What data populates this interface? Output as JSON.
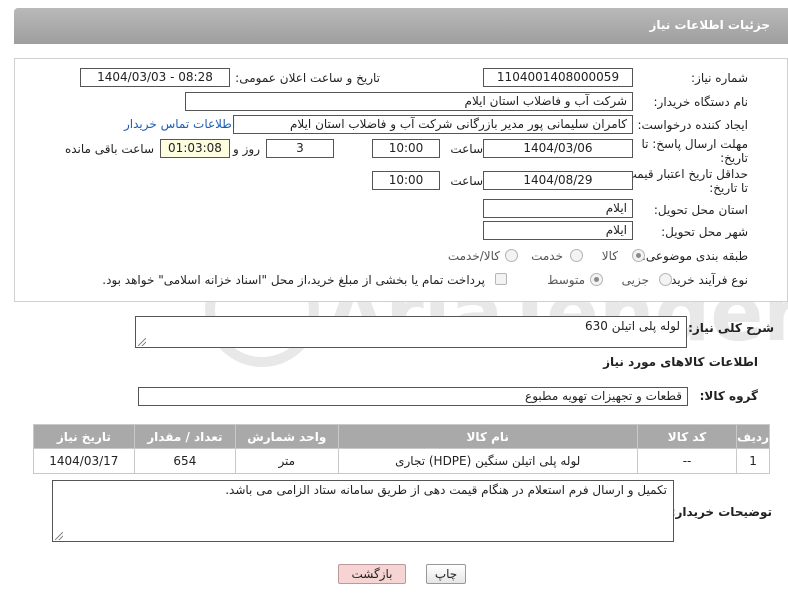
{
  "header": {
    "title": "جزئیات اطلاعات نیاز"
  },
  "fields": {
    "need_number_label": "شماره نیاز:",
    "need_number": "1104001408000059",
    "announce_label": "تاریخ و ساعت اعلان عمومی:",
    "announce_value": "1404/03/03 - 08:28",
    "buyer_org_label": "نام دستگاه خریدار:",
    "buyer_org": "شرکت آب و فاضلاب استان ایلام",
    "creator_label": "ایجاد کننده درخواست:",
    "creator": "کامران سلیمانی پور مدیر بازرگانی شرکت آب و فاضلاب استان ایلام",
    "buyer_contact_link": "اطلاعات تماس خریدار",
    "deadline_label_1": "مهلت ارسال پاسخ: تا",
    "deadline_label_2": "تاریخ:",
    "deadline_date": "1404/03/06",
    "time_label": "ساعت",
    "deadline_time": "10:00",
    "days_value": "3",
    "days_label": "روز و",
    "remaining_time": "01:03:08",
    "remaining_label": "ساعت باقی مانده",
    "price_valid_label_1": "حداقل تاریخ اعتبار قیمت:",
    "price_valid_label_2": "تا تاریخ:",
    "price_valid_date": "1404/08/29",
    "price_valid_time": "10:00",
    "province_label": "استان محل تحویل:",
    "province": "ایلام",
    "city_label": "شهر محل تحویل:",
    "city": "ایلام",
    "category_label": "طبقه بندی موضوعی:",
    "category_options": [
      "کالا",
      "خدمت",
      "کالا/خدمت"
    ],
    "process_label": "نوع فرآیند خرید :",
    "process_options": [
      "جزیی",
      "متوسط"
    ],
    "payment_note": "پرداخت تمام یا بخشی از مبلغ خرید،از محل \"اسناد خزانه اسلامی\" خواهد بود."
  },
  "description": {
    "label": "شرح کلی نیاز:",
    "value": "لوله پلی اتیلن 630"
  },
  "goods_section": {
    "title": "اطلاعات کالاهای مورد نیاز",
    "group_label": "گروه کالا:",
    "group_value": "قطعات و تجهیزات تهویه مطبوع"
  },
  "table": {
    "headers": [
      "ردیف",
      "کد کالا",
      "نام کالا",
      "واحد شمارش",
      "تعداد / مقدار",
      "تاریخ نیاز"
    ],
    "rows": [
      [
        "1",
        "--",
        "لوله پلی اتیلن سنگین (HDPE) تجاری",
        "متر",
        "654",
        "1404/03/17"
      ]
    ]
  },
  "buyer_notes": {
    "label": "توضیحات خریدار:",
    "value": "تکمیل و ارسال فرم استعلام در هنگام قیمت دهی از طریق سامانه ستاد الزامی می باشد."
  },
  "buttons": {
    "print": "چاپ",
    "back": "بازگشت"
  },
  "watermark": {
    "text": "AriaTender.neT"
  }
}
